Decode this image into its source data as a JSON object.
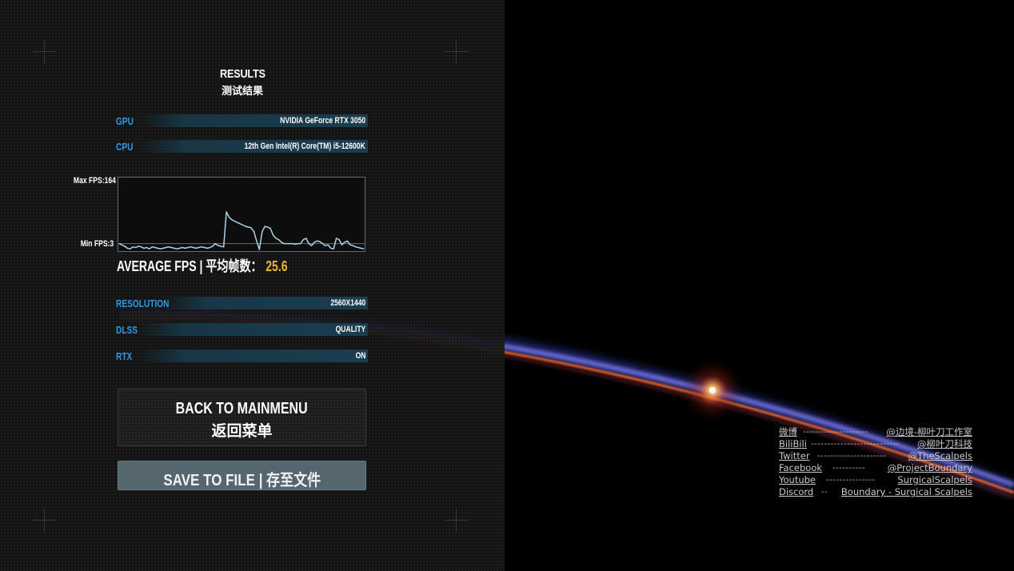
{
  "results": {
    "title_en": "RESULTS",
    "title_zh": "测试结果"
  },
  "hardware": [
    {
      "label": "GPU",
      "value": "NVIDIA GeForce RTX 3050"
    },
    {
      "label": "CPU",
      "value": "12th Gen Intel(R) Core(TM) i5-12600K"
    }
  ],
  "chart_data": {
    "type": "line",
    "title": "",
    "max_label": "Max FPS:164",
    "min_label": "Min FPS:3",
    "ylim": [
      3,
      164
    ],
    "reference_line": 12,
    "series": [
      {
        "name": "FPS",
        "values": [
          12,
          10,
          8,
          5,
          4,
          7,
          6,
          8,
          7,
          5,
          6,
          4,
          7,
          6,
          5,
          4,
          5,
          6,
          7,
          6,
          5,
          4,
          5,
          6,
          5,
          6,
          7,
          6,
          5,
          6,
          7,
          6,
          5,
          6,
          8,
          12,
          9,
          8,
          7,
          60,
          52,
          48,
          46,
          44,
          42,
          40,
          38,
          37,
          36,
          30,
          16,
          3,
          30,
          38,
          37,
          35,
          25,
          20,
          18,
          14,
          12,
          12,
          12,
          12,
          11,
          12,
          12,
          18,
          20,
          12,
          9,
          14,
          16,
          15,
          12,
          9,
          10,
          5,
          4,
          20,
          18,
          10,
          14,
          16,
          10,
          9,
          7,
          6,
          5,
          4
        ]
      }
    ]
  },
  "average": {
    "label": "AVERAGE FPS | 平均帧数：",
    "value": "25.6"
  },
  "settings": [
    {
      "label": "RESOLUTION",
      "value": "2560X1440"
    },
    {
      "label": "DLSS",
      "value": "QUALITY"
    },
    {
      "label": "RTX",
      "value": "ON"
    }
  ],
  "buttons": {
    "back_en": "BACK TO MAINMENU",
    "back_zh": "返回菜单",
    "save": "SAVE TO FILE | 存至文件"
  },
  "social": [
    {
      "name": "微博",
      "dashes": "--------------------",
      "handle": "@边境-柳叶刀工作室"
    },
    {
      "name": "BiliBili",
      "dashes": "---------------------------",
      "handle": "@柳叶刀科技"
    },
    {
      "name": "Twitter",
      "dashes": "---------------------",
      "handle": "@TheScalpels"
    },
    {
      "name": "Facebook",
      "dashes": "----------",
      "handle": "@ProjectBoundary"
    },
    {
      "name": "Youtube",
      "dashes": "---------------",
      "handle": "SurgicalScalpels"
    },
    {
      "name": "Discord",
      "dashes": "--",
      "handle": "Boundary - Surgical Scalpels"
    }
  ],
  "colors": {
    "label_blue": "#2e9ae6",
    "average_yellow": "#f0b43a",
    "chart_line": "#a9d6ea"
  }
}
